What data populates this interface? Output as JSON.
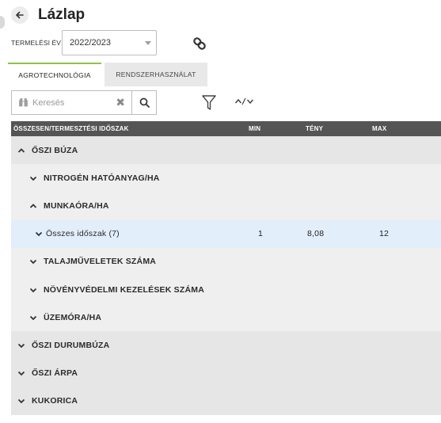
{
  "page": {
    "title": "Lázlap"
  },
  "filters": {
    "year_label": "TERMELÉSI ÉV",
    "year_value": "2022/2023"
  },
  "tabs": [
    {
      "label": "AGROTECHNOLÓGIA",
      "active": true
    },
    {
      "label": "RENDSZERHASZNÁLAT",
      "active": false
    }
  ],
  "search": {
    "placeholder": "Keresés",
    "value": ""
  },
  "toolbar": {
    "sort_label": "^/v"
  },
  "table": {
    "headers": {
      "name": "ÖSSZESEN/TERMESZTÉSI IDŐSZAK",
      "min": "MIN",
      "teny": "TÉNY",
      "max": "MAX"
    },
    "rows": [
      {
        "label": "ŐSZI BÚZA",
        "level": 0,
        "expanded": true
      },
      {
        "label": "NITROGÉN HATÓANYAG/HA",
        "level": 1,
        "expanded": false
      },
      {
        "label": "MUNKAÓRA/HA",
        "level": 1,
        "expanded": true
      },
      {
        "label": "Összes időszak (7)",
        "level": 2,
        "expanded": false,
        "min": "1",
        "teny": "8,08",
        "max": "12"
      },
      {
        "label": "TALAJMŰVELETEK SZÁMA",
        "level": 1,
        "expanded": false
      },
      {
        "label": "NÖVÉNYVÉDELMI KEZELÉSEK SZÁMA",
        "level": 1,
        "expanded": false
      },
      {
        "label": "ÜZEMÓRA/HA",
        "level": 1,
        "expanded": false
      },
      {
        "label": "ŐSZI DURUMBÚZA",
        "level": 0,
        "expanded": false
      },
      {
        "label": "ŐSZI ÁRPA",
        "level": 0,
        "expanded": false
      },
      {
        "label": "KUKORICA",
        "level": 0,
        "expanded": false
      }
    ]
  },
  "colors": {
    "accent_green": "#8bc34a",
    "header_bg": "#555555",
    "selected_row": "#e3eefb"
  },
  "icons": [
    "arrow-left-icon",
    "link-icon",
    "search-icon",
    "clear-icon",
    "filter-icon",
    "chevron-up-icon",
    "chevron-down-icon"
  ]
}
